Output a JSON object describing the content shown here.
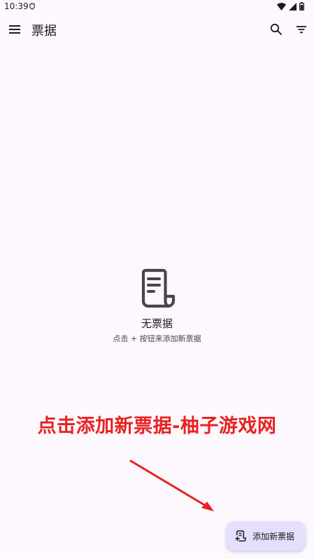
{
  "status_bar": {
    "time": "10:39",
    "icons": [
      "shield-icon",
      "wifi-icon",
      "signal-icon",
      "battery-icon"
    ]
  },
  "app_bar": {
    "title": "票据",
    "icons": [
      "menu-icon",
      "search-icon",
      "filter-icon"
    ]
  },
  "empty_state": {
    "icon": "receipt-icon",
    "title": "无票据",
    "hint": "点击 + 按钮来添加新票据"
  },
  "watermark": {
    "text": "点击添加新票据-柚子游戏网"
  },
  "fab": {
    "label": "添加新票据",
    "icon": "add-receipt-icon"
  },
  "colors": {
    "background": "#fdf7fe",
    "fab": "#e4dffc",
    "annotation": "#e8221f"
  }
}
